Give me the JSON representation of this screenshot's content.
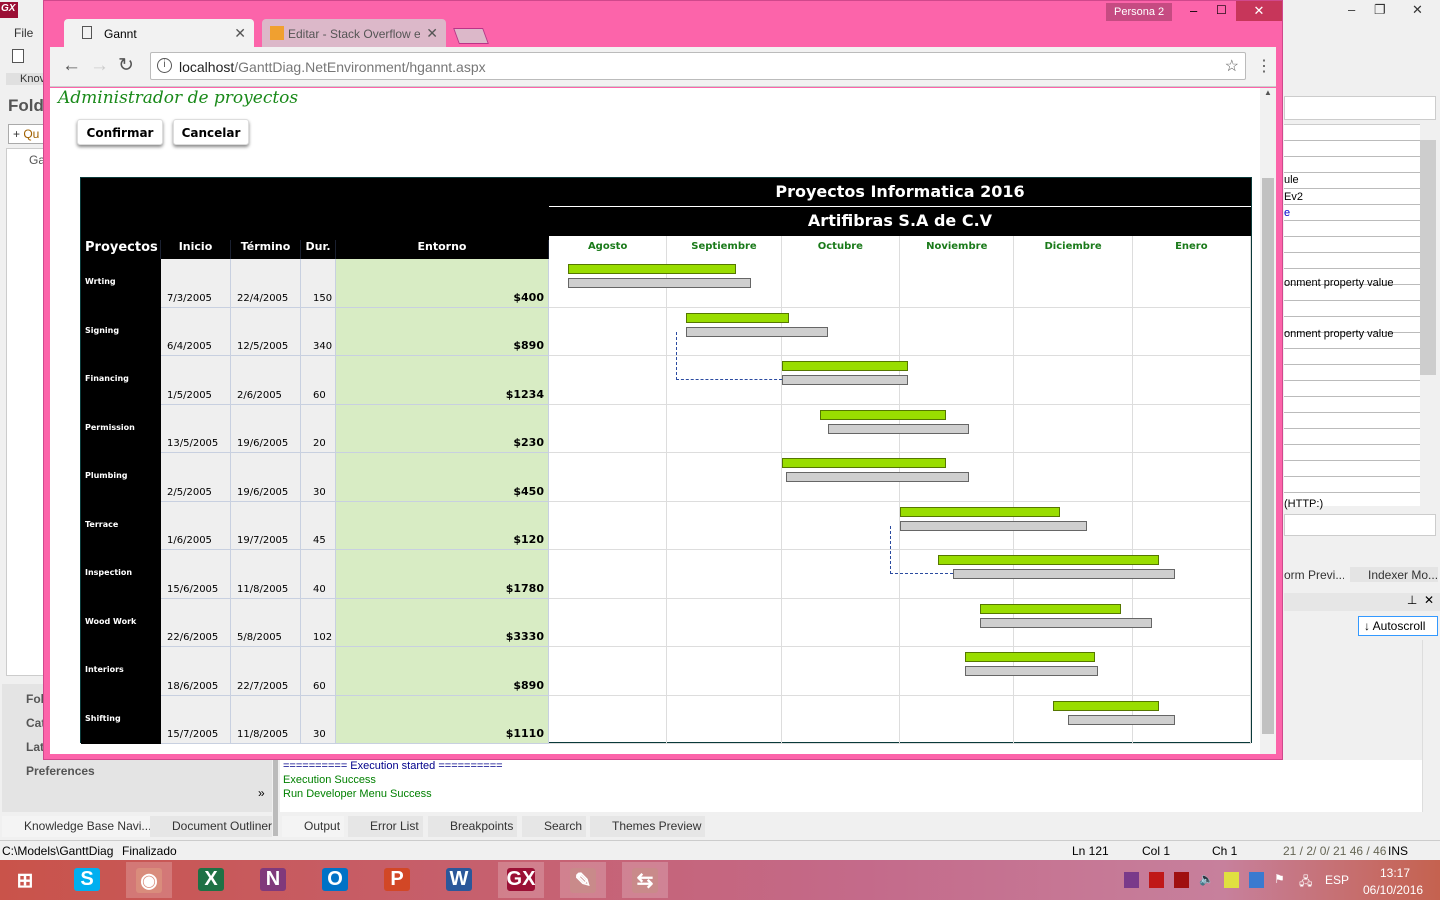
{
  "ide": {
    "logo": "GX",
    "menu_file": "File",
    "kb_tab": "Knov",
    "folders_header": "Fold",
    "quick_add": "Qu",
    "tree_root": "Ga",
    "nav_items": [
      "Fol",
      "Cat",
      "Lat",
      "Preferences"
    ],
    "output_lines": [
      "========== Execution started ==========",
      "Execution Success",
      "Run Developer Menu Success"
    ],
    "bottom_tabs_left": [
      "Knowledge Base Navi...",
      "Document Outliner"
    ],
    "bottom_tabs_right": [
      "Output",
      "Error List",
      "Breakpoints",
      "Search",
      "Themes Preview"
    ],
    "right_panel_lines": [
      "ule",
      "Ev2",
      "e",
      "onment property value",
      "onment property value",
      "(HTTP:)"
    ],
    "right_tabs": [
      "orm Previ...",
      "Indexer Mo..."
    ],
    "autoscroll": "Autoscroll",
    "status": {
      "path": "C:\\Models\\GanttDiag",
      "state": "Finalizado",
      "ln": "Ln 121",
      "col": "Col 1",
      "ch": "Ch 1",
      "counts": "21 / 2/ 0/ 21  46 / 46",
      "mode": "INS"
    }
  },
  "chrome": {
    "profile": "Persona 2",
    "tabs": [
      {
        "title": "Gannt"
      },
      {
        "title": "Editar - Stack Overflow e"
      }
    ],
    "url_host": "localhost",
    "url_path": "/GanttDiag.NetEnvironment/hgannt.aspx"
  },
  "page": {
    "title": "Administrador de proyectos",
    "confirm": "Confirmar",
    "cancel": "Cancelar"
  },
  "chart_data": {
    "type": "gantt",
    "title": "Proyectos Informatica 2016",
    "subtitle": "Artifibras S.A de C.V",
    "columns": [
      "Proyectos",
      "Inicio",
      "Término",
      "Dur.",
      "Entorno"
    ],
    "months": [
      "Agosto",
      "Septiembre",
      "Octubre",
      "Noviembre",
      "Diciembre",
      "Enero"
    ],
    "axis_range": [
      "2016-08-01",
      "2017-02-01"
    ],
    "colors": {
      "planned": "#99dd00",
      "actual": "#cfcfcf",
      "entorno_bg": "#d8ecc4",
      "link": "#2a4aa0"
    },
    "tasks": [
      {
        "name": "Wrting",
        "inicio": "7/3/2005",
        "termino": "22/4/2005",
        "dur": "150",
        "entorno": "$400",
        "planned": [
          "2016-08-06",
          "2016-09-19"
        ],
        "actual": [
          "2016-08-06",
          "2016-09-23"
        ]
      },
      {
        "name": "Signing",
        "inicio": "6/4/2005",
        "termino": "12/5/2005",
        "dur": "340",
        "entorno": "$890",
        "planned": [
          "2016-09-06",
          "2016-10-03"
        ],
        "actual": [
          "2016-09-06",
          "2016-10-13"
        ]
      },
      {
        "name": "Financing",
        "inicio": "1/5/2005",
        "termino": "2/6/2005",
        "dur": "60",
        "entorno": "$1234",
        "planned": [
          "2016-10-01",
          "2016-11-03"
        ],
        "actual": [
          "2016-10-01",
          "2016-11-03"
        ]
      },
      {
        "name": "Permission",
        "inicio": "13/5/2005",
        "termino": "19/6/2005",
        "dur": "20",
        "entorno": "$230",
        "planned": [
          "2016-10-11",
          "2016-11-13"
        ],
        "actual": [
          "2016-10-13",
          "2016-11-19"
        ]
      },
      {
        "name": "Plumbing",
        "inicio": "2/5/2005",
        "termino": "19/6/2005",
        "dur": "30",
        "entorno": "$450",
        "planned": [
          "2016-10-01",
          "2016-11-13"
        ],
        "actual": [
          "2016-10-02",
          "2016-11-19"
        ]
      },
      {
        "name": "Terrace",
        "inicio": "1/6/2005",
        "termino": "19/7/2005",
        "dur": "45",
        "entorno": "$120",
        "planned": [
          "2016-11-01",
          "2016-12-13"
        ],
        "actual": [
          "2016-11-01",
          "2016-12-20"
        ]
      },
      {
        "name": "Inspection",
        "inicio": "15/6/2005",
        "termino": "11/8/2005",
        "dur": "40",
        "entorno": "$1780",
        "planned": [
          "2016-11-11",
          "2017-01-08"
        ],
        "actual": [
          "2016-11-15",
          "2017-01-12"
        ]
      },
      {
        "name": "Wood Work",
        "inicio": "22/6/2005",
        "termino": "5/8/2005",
        "dur": "102",
        "entorno": "$3330",
        "planned": [
          "2016-11-22",
          "2016-12-29"
        ],
        "actual": [
          "2016-11-22",
          "2017-01-06"
        ]
      },
      {
        "name": "Interiors",
        "inicio": "18/6/2005",
        "termino": "22/7/2005",
        "dur": "60",
        "entorno": "$890",
        "planned": [
          "2016-11-18",
          "2016-12-22"
        ],
        "actual": [
          "2016-11-18",
          "2016-12-23"
        ]
      },
      {
        "name": "Shifting",
        "inicio": "15/7/2005",
        "termino": "11/8/2005",
        "dur": "30",
        "entorno": "$1110",
        "planned": [
          "2016-12-11",
          "2017-01-08"
        ],
        "actual": [
          "2016-12-15",
          "2017-01-12"
        ]
      }
    ],
    "links": [
      {
        "from": 1,
        "to": 2
      },
      {
        "from": 5,
        "to": 6
      }
    ]
  },
  "taskbar": {
    "apps": [
      "start",
      "skype",
      "chrome",
      "excel",
      "onenote",
      "outlook",
      "powerpoint",
      "word",
      "genexus",
      "notepad",
      "teamviewer"
    ],
    "lang": "ESP",
    "time": "13:17",
    "date": "06/10/2016"
  }
}
